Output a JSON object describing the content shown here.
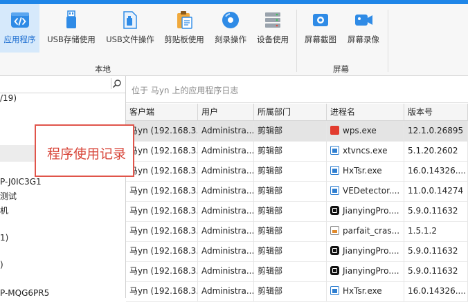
{
  "toolbar": {
    "items": [
      {
        "label": "应用程序",
        "icon": "code-window-icon"
      },
      {
        "label": "USB存储使用",
        "icon": "usb-icon"
      },
      {
        "label": "USB文件操作",
        "icon": "usb-file-icon"
      },
      {
        "label": "剪贴板使用",
        "icon": "clipboard-icon"
      },
      {
        "label": "刻录操作",
        "icon": "disc-icon"
      },
      {
        "label": "设备使用",
        "icon": "device-icon"
      },
      {
        "label": "屏幕截图",
        "icon": "camera-icon"
      },
      {
        "label": "屏幕录像",
        "icon": "video-icon"
      }
    ],
    "group_local": "本地",
    "group_screen": "屏幕"
  },
  "colors": {
    "accent": "#1f86e8",
    "annotation": "#e0544a"
  },
  "tree": {
    "nodes": [
      "/19)",
      "P-J0IC3G1",
      "测试",
      "机",
      "1)",
      ")",
      "P-MQG6PR5"
    ]
  },
  "search": {
    "placeholder": "位于 马yn 上的应用程序日志"
  },
  "table": {
    "headers": [
      "客户端",
      "用户",
      "所属部门",
      "进程名",
      "版本号"
    ],
    "rows": [
      {
        "client": "马yn (192.168.3...",
        "user": "Administra...",
        "dept": "剪辑部",
        "process": "wps.exe",
        "icon": "wps-icon",
        "version": "12.1.0.26895"
      },
      {
        "client": "马yn (192.168.3...",
        "user": "Administra...",
        "dept": "剪辑部",
        "process": "xtvncs.exe",
        "icon": "window-icon",
        "version": "5.1.20.2602"
      },
      {
        "client": "马yn (192.168.3...",
        "user": "Administra...",
        "dept": "剪辑部",
        "process": "HxTsr.exe",
        "icon": "window-icon",
        "version": "16.0.14326...."
      },
      {
        "client": "马yn (192.168.3...",
        "user": "Administra...",
        "dept": "剪辑部",
        "process": "VEDetector....",
        "icon": "window-icon",
        "version": "11.0.0.14274"
      },
      {
        "client": "马yn (192.168.3...",
        "user": "Administra...",
        "dept": "剪辑部",
        "process": "JianyingPro....",
        "icon": "capcut-icon",
        "version": "5.9.0.11632"
      },
      {
        "client": "马yn (192.168.3...",
        "user": "Administra...",
        "dept": "剪辑部",
        "process": "parfait_cras...",
        "icon": "document-icon",
        "version": "1.5.1.2"
      },
      {
        "client": "马yn (192.168.3...",
        "user": "Administra...",
        "dept": "剪辑部",
        "process": "JianyingPro....",
        "icon": "capcut-icon",
        "version": "5.9.0.11632"
      },
      {
        "client": "马yn (192.168.3...",
        "user": "Administra...",
        "dept": "剪辑部",
        "process": "JianyingPro....",
        "icon": "capcut-icon",
        "version": "5.9.0.11632"
      },
      {
        "client": "马yn (192.168.3...",
        "user": "Administra...",
        "dept": "剪辑部",
        "process": "HxTsr.exe",
        "icon": "window-icon",
        "version": "16.0.14326...."
      }
    ]
  },
  "annotation": {
    "text": "程序使用记录"
  }
}
